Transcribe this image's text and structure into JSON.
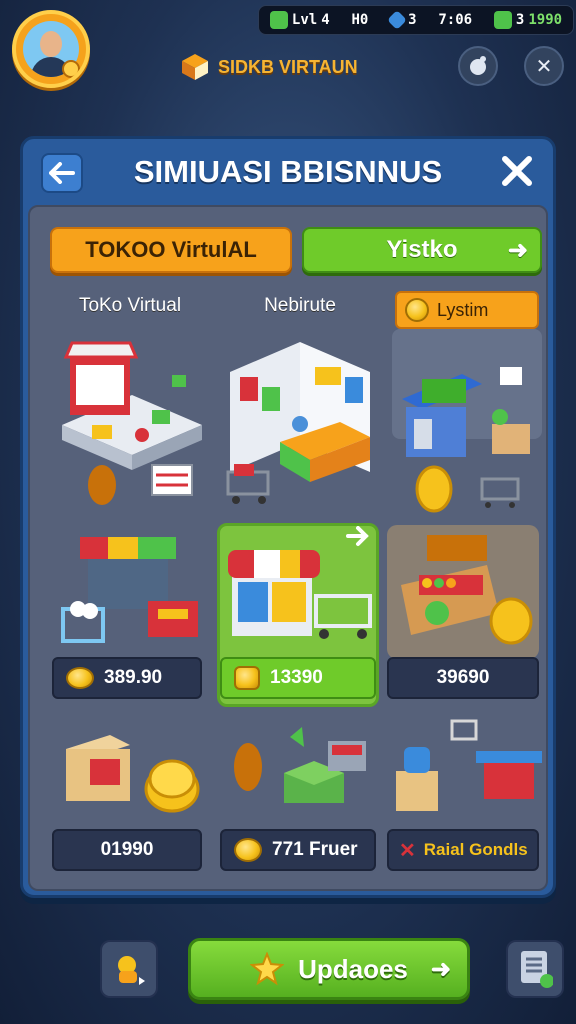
{
  "hud": {
    "avatar": "avatar",
    "resources": [
      {
        "label": "Lvl",
        "value": "4",
        "color": "#4fc24a"
      },
      {
        "label": "",
        "value": "H0",
        "color": "#f6c21c"
      },
      {
        "label": "",
        "value": "3",
        "color": "#3a8bdc"
      },
      {
        "label": "",
        "value": "7:06",
        "color": "#ffffff"
      },
      {
        "label": "3",
        "value": "1990",
        "color": "#4fc24a"
      }
    ],
    "game_title": "SIDKB VIRTAUN",
    "top_buttons": [
      "notification-icon",
      "close-icon"
    ]
  },
  "panel": {
    "title": "SIMIUASI BBISNNUS",
    "tabs": [
      {
        "label": "TOKOO VirtulAL"
      },
      {
        "label": "Yistko"
      }
    ],
    "categories": [
      "ToKo Virtual",
      "Nebirute",
      "Lystim"
    ],
    "shops": [
      {
        "price": "389.90"
      },
      {
        "price": "13390"
      },
      {
        "price": "39690"
      },
      {
        "price": "01990"
      },
      {
        "price": "771 Fruer"
      },
      {
        "price": "Raial Gondls"
      }
    ]
  },
  "bottom": {
    "update_label": "Updaoes"
  },
  "colors": {
    "panel_blue": "#2a5b9c",
    "accent_orange": "#f7a21b",
    "accent_green": "#6fcb2a",
    "price_dark": "#2a3550"
  }
}
